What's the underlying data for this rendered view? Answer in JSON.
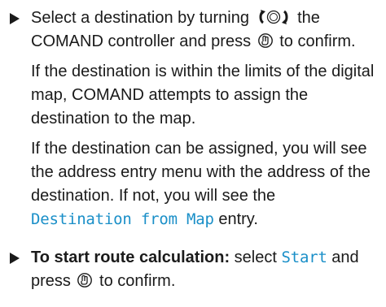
{
  "instructions": {
    "step1": {
      "text_before_icon": "Select a destination by turning",
      "turn_icon": "controller-turn-icon",
      "text_after_icon": "the COMAND controller and press",
      "press_icon": "controller-press-icon",
      "text_end": "to confirm.",
      "para2": "If the destination is within the limits of the digital map, COMAND attempts to assign the destination to the map.",
      "para3_before": "If the destination can be assigned, you will see the address entry menu with the address of the destination. If not, you will see the",
      "para3_display": "Destination from Map",
      "para3_after": "entry."
    },
    "step2": {
      "bold_lead": "To start route calculation:",
      "text_select": "select",
      "display_start": "Start",
      "text_and_press": "and press",
      "press_icon": "controller-press-icon",
      "text_end": "to confirm."
    }
  },
  "colors": {
    "text": "#1a1a1a",
    "display_text": "#1a8fc8",
    "bullet": "#1a1a1a"
  }
}
